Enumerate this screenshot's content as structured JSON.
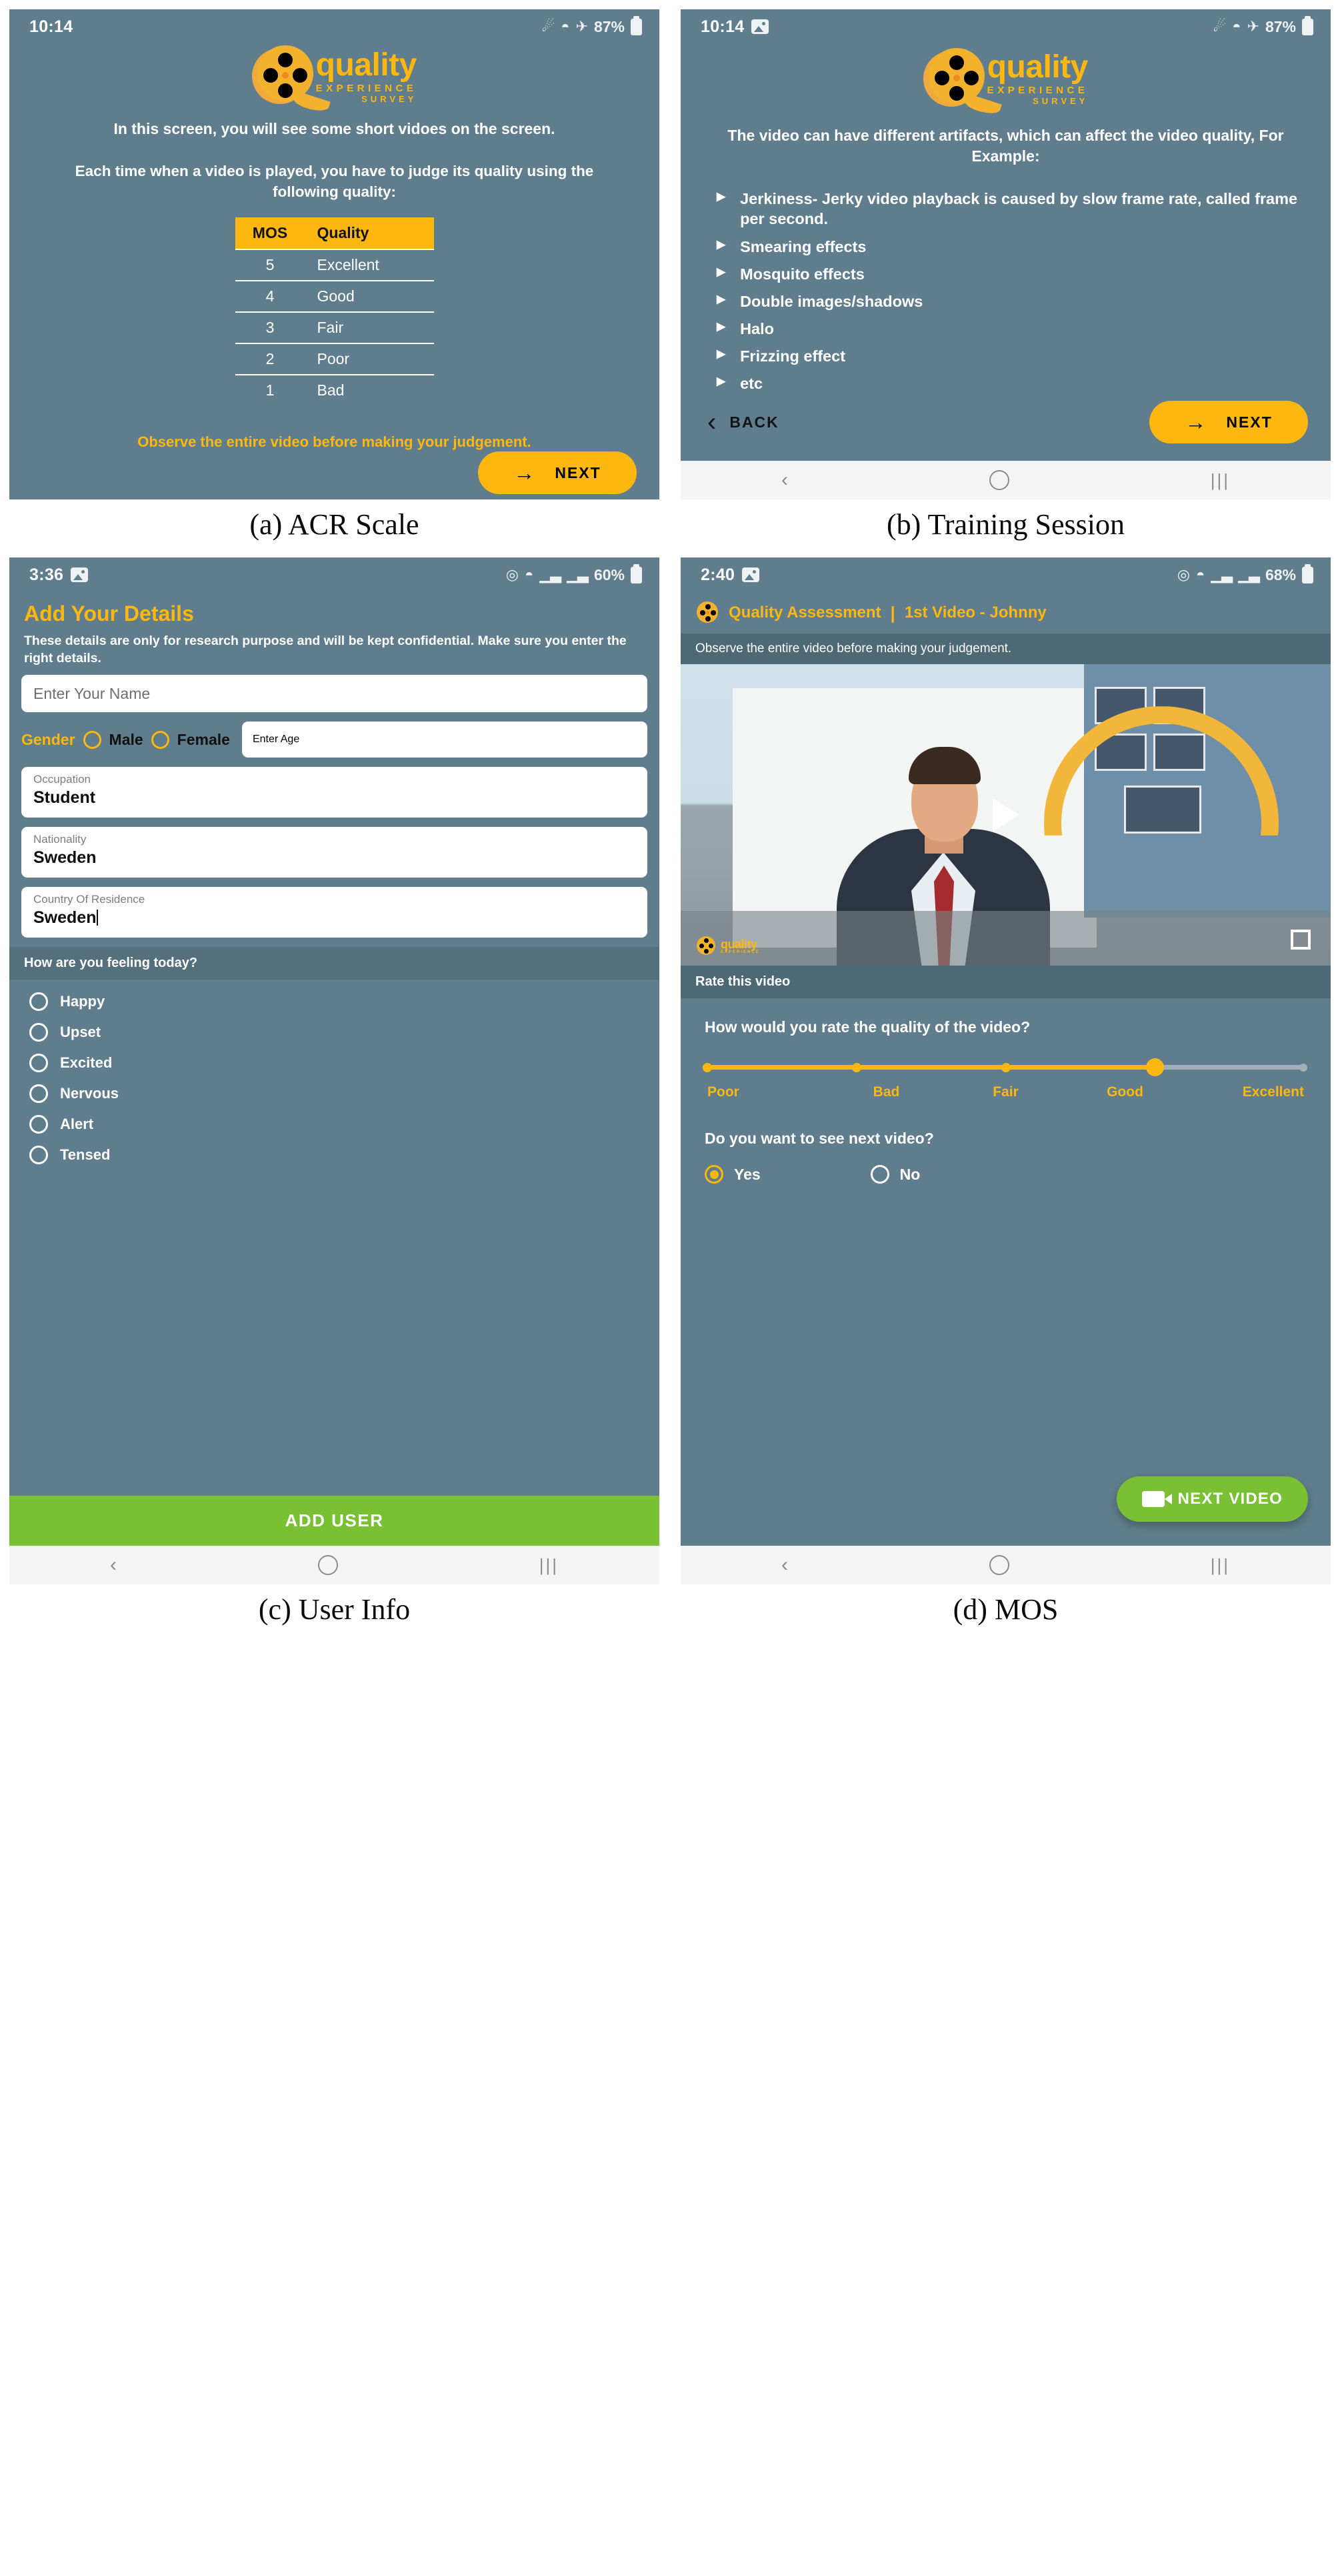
{
  "figure": {
    "captions": {
      "a": "(a) ACR Scale",
      "b": "(b) Training Session",
      "c": "(c) User Info",
      "d": "(d) MOS"
    }
  },
  "logo": {
    "word1": "quality",
    "word2": "EXPERIENCE",
    "word3": "SURVEY",
    "color": "#fcb711"
  },
  "panel_a": {
    "status": {
      "time": "10:14",
      "bluetooth": "bluetooth-icon",
      "wifi": "wifi-icon",
      "airplane": "airplane-icon",
      "battery": "87%"
    },
    "intro": "In this screen, you will see some short vidoes on the screen.",
    "instruction": "Each time when a video is played, you have to judge its quality using the following quality:",
    "table": {
      "headers": [
        "MOS",
        "Quality"
      ],
      "rows": [
        {
          "mos": "5",
          "quality": "Excellent"
        },
        {
          "mos": "4",
          "quality": "Good"
        },
        {
          "mos": "3",
          "quality": "Fair"
        },
        {
          "mos": "2",
          "quality": "Poor"
        },
        {
          "mos": "1",
          "quality": "Bad"
        }
      ]
    },
    "observe": "Observe the entire video before making your judgement.",
    "next_label": "NEXT",
    "nav": {
      "back": "back-icon",
      "home": "home-icon",
      "recents": "recents-icon"
    }
  },
  "panel_b": {
    "status": {
      "time": "10:14",
      "battery": "87%"
    },
    "heading": "The video can have different artifacts, which can affect the video quality, For Example:",
    "bullets": [
      "Jerkiness- Jerky video playback is caused by slow frame rate, called frame per second.",
      "Smearing effects",
      "Mosquito effects",
      "Double images/shadows",
      "Halo",
      "Frizzing effect",
      "etc"
    ],
    "back_label": "BACK",
    "next_label": "NEXT"
  },
  "panel_c": {
    "status": {
      "time": "3:36",
      "battery": "60%"
    },
    "title": "Add Your Details",
    "subtitle": "These details are only for research purpose and will be kept confidential. Make sure you enter the right details.",
    "name_placeholder": "Enter Your Name",
    "gender_label": "Gender",
    "gender_options": [
      "Male",
      "Female"
    ],
    "age_placeholder": "Enter Age",
    "fields": [
      {
        "label": "Occupation",
        "value": "Student"
      },
      {
        "label": "Nationality",
        "value": "Sweden"
      },
      {
        "label": "Country Of Residence",
        "value": "Sweden"
      }
    ],
    "feeling_header": "How are you feeling today?",
    "feelings": [
      "Happy",
      "Upset",
      "Excited",
      "Nervous",
      "Alert",
      "Tensed"
    ],
    "add_user_label": "ADD USER"
  },
  "panel_d": {
    "status": {
      "time": "2:40",
      "battery": "68%"
    },
    "header_title": "Quality Assessment",
    "header_divider": "|",
    "header_video": "1st Video - Johnny",
    "note": "Observe the entire video before making your judgement.",
    "rate_bar": "Rate this video",
    "question": "How would you rate the quality of the video?",
    "scale": [
      "Poor",
      "Bad",
      "Fair",
      "Good",
      "Excellent"
    ],
    "selected_rating": "Good",
    "selected_index": 3,
    "next_question": "Do you want to see next video?",
    "yes_label": "Yes",
    "no_label": "No",
    "selected_answer": "Yes",
    "next_video_label": "NEXT VIDEO"
  }
}
